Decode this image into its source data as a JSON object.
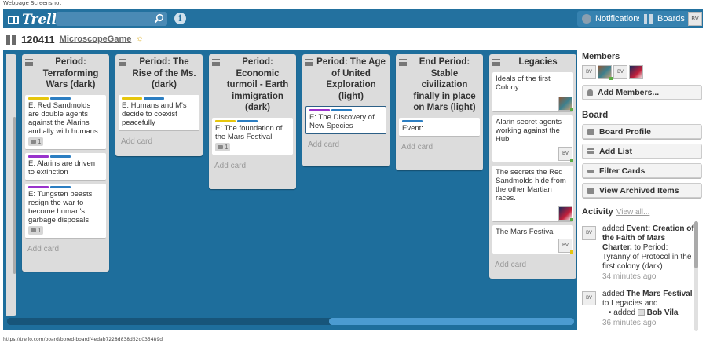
{
  "page": {
    "caption_top": "Webpage Screenshot",
    "caption_bottom": "https://trello.com/board/bored-board/4edab7228d838d52d035489d"
  },
  "header": {
    "logo": "Trello",
    "search_placeholder": "",
    "info_icon": "info-icon",
    "notifications_label": "Notifications",
    "boards_label": "Boards",
    "user_initials": "BV",
    "colors": {
      "bar": "#23719f",
      "button": "#3682b0"
    }
  },
  "board": {
    "number": "120411",
    "name": "MicroscopeGame",
    "background": "#1e6e9c"
  },
  "lists": [
    {
      "title": "Period: Terraforming Wars (dark)",
      "cards": [
        {
          "labels": [
            "#e6c60d",
            "#2c7ec2"
          ],
          "text": "E: Red Sandmolds are double agents against the Alarins and ally with humans.",
          "comments": "1"
        },
        {
          "labels": [
            "#9933cc",
            "#2c7ec2"
          ],
          "text": "E: Alarins are driven to extinction"
        },
        {
          "labels": [
            "#9933cc",
            "#2c7ec2"
          ],
          "text": "E: Tungsten beasts resign the war to become human's garbage disposals.",
          "comments": "1"
        }
      ],
      "add_card": "Add card"
    },
    {
      "title": "Period: The Rise of the Ms. (dark)",
      "cards": [
        {
          "labels": [
            "#e6c60d",
            "#2c7ec2"
          ],
          "text": "E: Humans and M's decide to coexist peacefully"
        }
      ],
      "add_card": "Add card"
    },
    {
      "title": "Period: Economic turmoil - Earth immigration (dark)",
      "cards": [
        {
          "labels": [
            "#e6c60d",
            "#2c7ec2"
          ],
          "text": "E: The foundation of the Mars Festival",
          "comments": "1"
        }
      ],
      "add_card": "Add card"
    },
    {
      "title": "Period: The Age of United Exploration (light)",
      "cards": [
        {
          "labels": [
            "#9933cc",
            "#2c7ec2"
          ],
          "text": "E: The Discovery of New Species",
          "selected": true
        }
      ],
      "add_card": "Add card"
    },
    {
      "title": "End Period: Stable civilization finally in place on Mars (light)",
      "cards": [
        {
          "labels": [
            "#2c7ec2"
          ],
          "text": "Event:"
        }
      ],
      "add_card": "Add card"
    },
    {
      "title": "Legacies",
      "cards": [
        {
          "text": "Ideals of the first Colony",
          "avatar": "pic"
        },
        {
          "text": "Alarin secret agents working against the Hub",
          "avatar": "BV"
        },
        {
          "text": "The secrets the Red Sandmolds hide from the other Martian races.",
          "avatar": "pic2"
        },
        {
          "text": "The Mars Festival",
          "avatar": "BV"
        }
      ],
      "add_card": "Add card"
    }
  ],
  "sidebar": {
    "members_heading": "Members",
    "members": [
      "BV",
      "pic",
      "BV",
      "pic2"
    ],
    "add_members": "Add Members...",
    "board_heading": "Board",
    "board_profile": "Board Profile",
    "add_list": "Add List",
    "filter_cards": "Filter Cards",
    "view_archived": "View Archived Items",
    "activity_heading": "Activity",
    "view_all": "View all...",
    "activity": [
      {
        "avatar": "BV",
        "prefix": "added ",
        "bold": "Event: Creation of the Faith of Mars Charter.",
        "middle": " to Period: Tyranny of Protocol in the first colony (dark)",
        "time": "34 minutes ago"
      },
      {
        "avatar": "BV",
        "prefix": "added ",
        "bold": "The Mars Festival",
        "middle": " to Legacies and",
        "bullet_prefix": "• added ",
        "bullet_bold": "Bob Vila",
        "time": "36 minutes ago"
      }
    ]
  }
}
